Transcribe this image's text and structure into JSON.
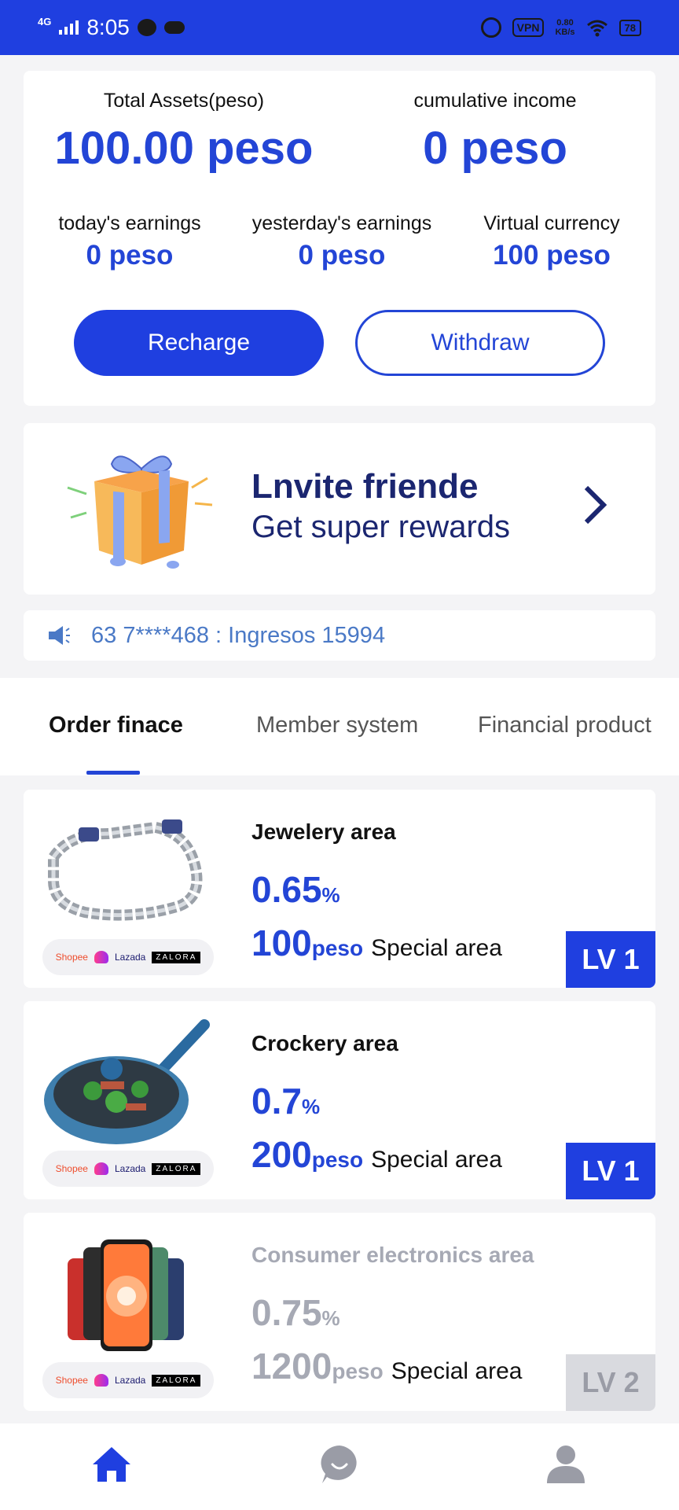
{
  "status_bar": {
    "network": "4G",
    "time": "8:05",
    "vpn": "VPN",
    "speed_value": "0.80",
    "speed_unit": "KB/s",
    "battery": "78"
  },
  "assets": {
    "total_label": "Total Assets(peso)",
    "total_value": "100.00 peso",
    "cumulative_label": "cumulative income",
    "cumulative_value": "0 peso",
    "today_label": "today's earnings",
    "today_value": "0 peso",
    "yesterday_label": "yesterday's earnings",
    "yesterday_value": "0 peso",
    "virtual_label": "Virtual currency",
    "virtual_value": "100 peso",
    "recharge_label": "Recharge",
    "withdraw_label": "Withdraw"
  },
  "invite": {
    "title": "Lnvite friende",
    "subtitle": "Get super rewards"
  },
  "notice": {
    "text": "63 7****468 : Ingresos 15994"
  },
  "tabs": [
    {
      "label": "Order finace",
      "active": true
    },
    {
      "label": "Member system",
      "active": false
    },
    {
      "label": "Financial product",
      "active": false
    }
  ],
  "brand_badges": {
    "shopee": "Shopee",
    "lazada": "Lazada",
    "zalora": "ZALORA"
  },
  "products": [
    {
      "name": "Jewelery area",
      "rate": "0.65",
      "rate_unit": "%",
      "price": "100",
      "price_unit": "peso",
      "special": "Special area",
      "level": "LV 1",
      "locked": false
    },
    {
      "name": "Crockery area",
      "rate": "0.7",
      "rate_unit": "%",
      "price": "200",
      "price_unit": "peso",
      "special": "Special area",
      "level": "LV 1",
      "locked": false
    },
    {
      "name": "Consumer electronics area",
      "rate": "0.75",
      "rate_unit": "%",
      "price": "1200",
      "price_unit": "peso",
      "special": "Special area",
      "level": "LV 2",
      "locked": true
    }
  ],
  "colors": {
    "primary": "#1f3fe0",
    "accent_text": "#2345d6",
    "locked_text": "#a6a9b4",
    "notice_text": "#4a79c6"
  },
  "bottom_nav": [
    "home-icon",
    "chat-icon",
    "profile-icon"
  ]
}
